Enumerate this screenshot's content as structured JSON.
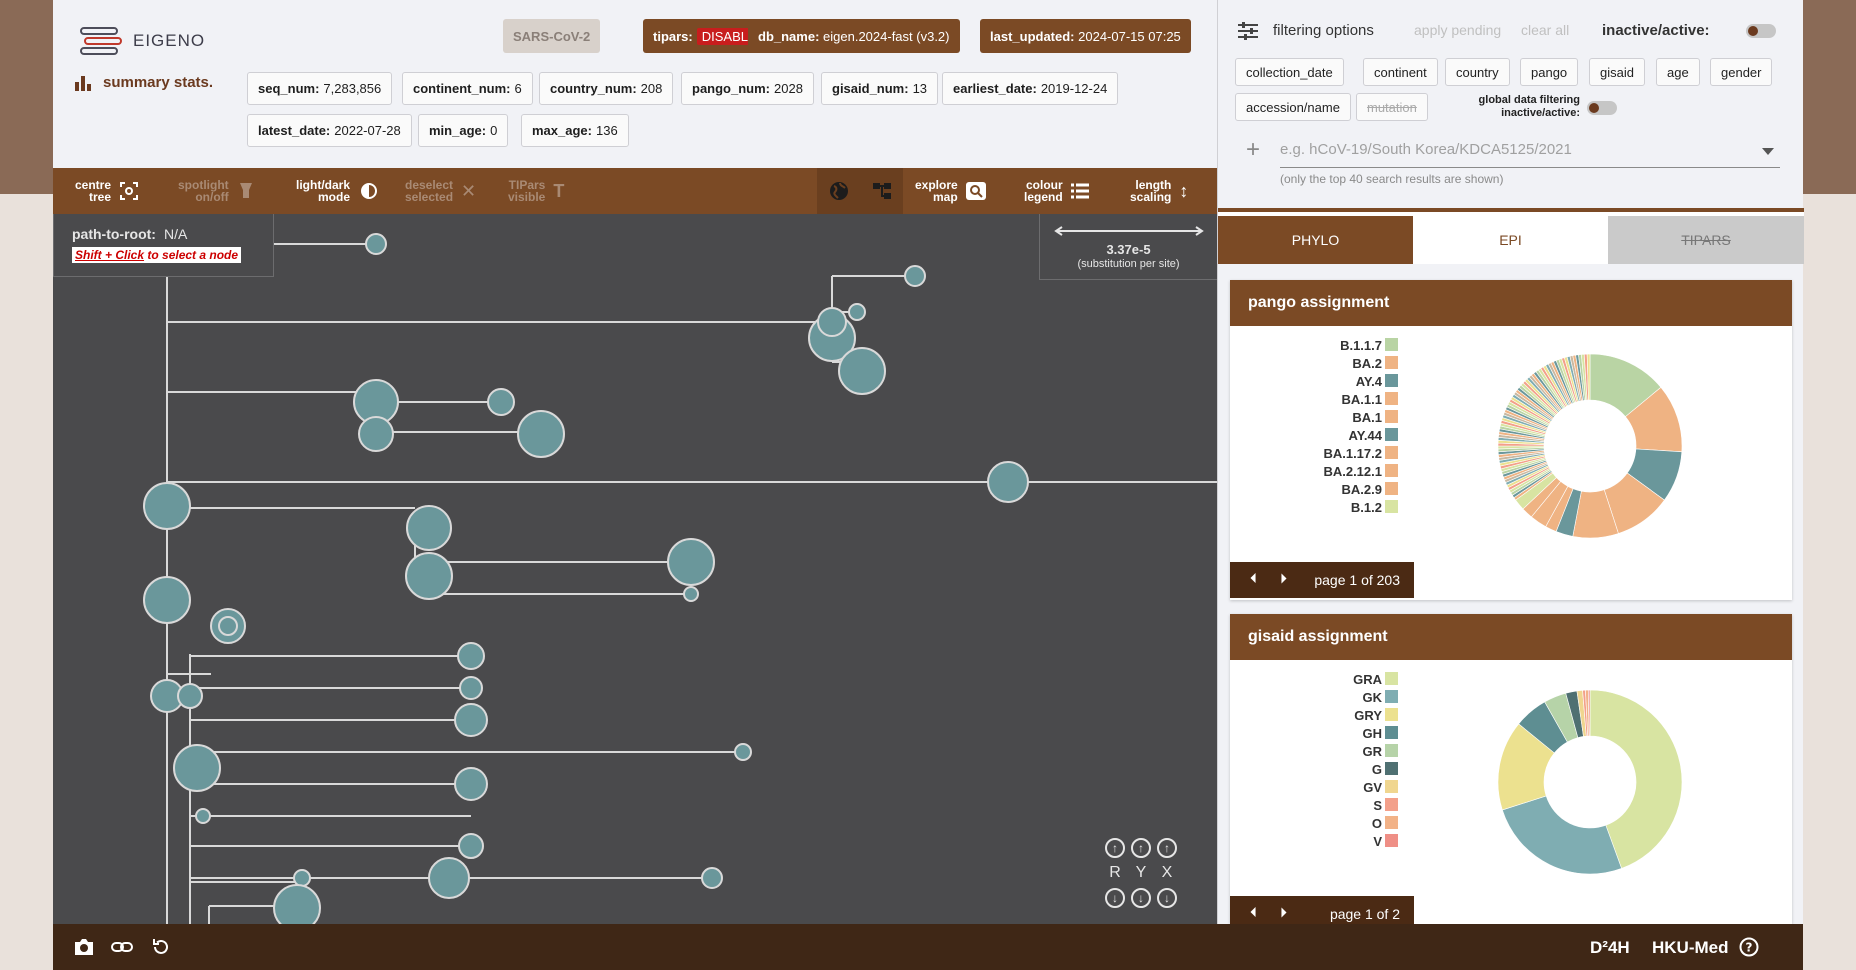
{
  "header": {
    "logo_text": "EIGENO",
    "summary_label": "summary stats.",
    "badges": {
      "virus": "SARS-CoV-2",
      "tipars_label": "tipars:",
      "tipars_value": "DISABLED",
      "db_name_label": "db_name:",
      "db_name_value": "eigen.2024-fast (v3.2)",
      "last_updated_label": "last_updated:",
      "last_updated_value": "2024-07-15 07:25"
    },
    "stats": [
      {
        "label": "seq_num:",
        "value": "7,283,856"
      },
      {
        "label": "continent_num:",
        "value": "6"
      },
      {
        "label": "country_num:",
        "value": "208"
      },
      {
        "label": "pango_num:",
        "value": "2028"
      },
      {
        "label": "gisaid_num:",
        "value": "13"
      },
      {
        "label": "earliest_date:",
        "value": "2019-12-24"
      },
      {
        "label": "latest_date:",
        "value": "2022-07-28"
      },
      {
        "label": "min_age:",
        "value": "0"
      },
      {
        "label": "max_age:",
        "value": "136"
      }
    ]
  },
  "toolbar": {
    "centre_tree": [
      "centre",
      "tree"
    ],
    "spotlight": [
      "spotlight",
      "on/off"
    ],
    "light_dark": [
      "light/dark",
      "mode"
    ],
    "deselect": [
      "deselect",
      "selected"
    ],
    "tipars_visible": [
      "TIPars",
      "visible"
    ],
    "explore_map": [
      "explore",
      "map"
    ],
    "colour_legend": [
      "colour",
      "legend"
    ],
    "length_scaling": [
      "length",
      "scaling"
    ]
  },
  "tree": {
    "path_to_root_label": "path-to-root:",
    "path_to_root_value": "N/A",
    "hint": "Shift + Click to select a node",
    "hint_shift": "Shift + Click",
    "hint_rest": " to select a node",
    "scale_value": "3.37e-5",
    "scale_unit": "(substitution per site)",
    "axes": [
      "R",
      "Y",
      "X"
    ]
  },
  "filter": {
    "title": "filtering options",
    "apply": "apply pending",
    "clear": "clear all",
    "inactive_active": "inactive/active:",
    "chips": [
      "collection_date",
      "continent",
      "country",
      "pango",
      "gisaid",
      "age",
      "gender",
      "accession/name",
      "mutation"
    ],
    "global_label_1": "global data filtering",
    "global_label_2": "inactive/active:",
    "search_placeholder": "e.g. hCoV-19/South Korea/KDCA5125/2021",
    "search_hint": "(only the top 40 search results are shown)"
  },
  "tabs": [
    "PHYLO",
    "EPI",
    "TIPARS"
  ],
  "pango_card": {
    "title": "pango assignment",
    "legend": [
      {
        "label": "B.1.1.7",
        "color": "#b9d4a4"
      },
      {
        "label": "BA.2",
        "color": "#efb383"
      },
      {
        "label": "AY.4",
        "color": "#6a979b"
      },
      {
        "label": "BA.1.1",
        "color": "#efb383"
      },
      {
        "label": "BA.1",
        "color": "#efb383"
      },
      {
        "label": "AY.44",
        "color": "#6a979b"
      },
      {
        "label": "BA.1.17.2",
        "color": "#efb383"
      },
      {
        "label": "BA.2.12.1",
        "color": "#efb383"
      },
      {
        "label": "BA.2.9",
        "color": "#efb383"
      },
      {
        "label": "B.1.2",
        "color": "#d8e4a2"
      }
    ],
    "page": "page 1 of 203"
  },
  "gisaid_card": {
    "title": "gisaid assignment",
    "legend": [
      {
        "label": "GRA",
        "color": "#d8e4a2"
      },
      {
        "label": "GK",
        "color": "#7fadb2"
      },
      {
        "label": "GRY",
        "color": "#ece18f"
      },
      {
        "label": "GH",
        "color": "#5e8e92"
      },
      {
        "label": "GR",
        "color": "#b6d3a8"
      },
      {
        "label": "G",
        "color": "#4f7072"
      },
      {
        "label": "GV",
        "color": "#f0d68f"
      },
      {
        "label": "S",
        "color": "#f3a08a"
      },
      {
        "label": "O",
        "color": "#f2b287"
      },
      {
        "label": "V",
        "color": "#ef8f86"
      }
    ],
    "page": "page 1 of 2"
  },
  "footer": {
    "d2h": "D²4H",
    "hku": "HKU-Med"
  },
  "colors": {
    "brown": "#7b4a25",
    "dark_brown": "#3f2716",
    "tree_bg": "#4a4a4c",
    "node_fill": "#6a979b"
  }
}
